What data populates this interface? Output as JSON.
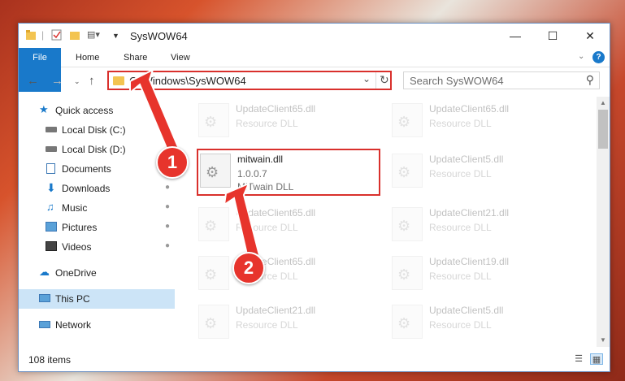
{
  "window": {
    "title": "SysWOW64"
  },
  "ribbon": {
    "tabs": [
      "File",
      "Home",
      "Share",
      "View"
    ]
  },
  "address": {
    "path": "C:\\Windows\\SysWOW64"
  },
  "search": {
    "placeholder": "Search SysWOW64"
  },
  "sidebar": {
    "items": [
      {
        "label": "Quick access",
        "icon": "star-icon"
      },
      {
        "label": "Local Disk (C:)",
        "icon": "drive-icon",
        "pinned": true
      },
      {
        "label": "Local Disk (D:)",
        "icon": "drive-icon"
      },
      {
        "label": "Documents",
        "icon": "documents-icon"
      },
      {
        "label": "Downloads",
        "icon": "download-icon",
        "pinned": true
      },
      {
        "label": "Music",
        "icon": "music-icon",
        "pinned": true
      },
      {
        "label": "Pictures",
        "icon": "pictures-icon",
        "pinned": true
      },
      {
        "label": "Videos",
        "icon": "videos-icon",
        "pinned": true
      },
      {
        "label": "OneDrive",
        "icon": "cloud-icon"
      },
      {
        "label": "This PC",
        "icon": "computer-icon",
        "selected": true
      },
      {
        "label": "Network",
        "icon": "network-icon"
      }
    ]
  },
  "files": [
    {
      "name": "UpdateClient65.dll",
      "type": "Resource DLL"
    },
    {
      "name": "UpdateClient65.dll",
      "type": "Resource DLL"
    },
    {
      "name": "mitwain.dll",
      "version": "1.0.0.7",
      "type": "MiTwain DLL"
    },
    {
      "name": "UpdateClient5.dll",
      "type": "Resource DLL"
    },
    {
      "name": "UpdateClient65.dll",
      "type": "Resource DLL"
    },
    {
      "name": "UpdateClient21.dll",
      "type": "Resource DLL"
    },
    {
      "name": "UpdateClient65.dll",
      "type": "Resource DLL"
    },
    {
      "name": "UpdateClient19.dll",
      "type": "Resource DLL"
    },
    {
      "name": "UpdateClient21.dll",
      "type": "Resource DLL"
    },
    {
      "name": "UpdateClient5.dll",
      "type": "Resource DLL"
    }
  ],
  "status": {
    "count": "108 items"
  },
  "annotations": {
    "badge1": "1",
    "badge2": "2"
  },
  "colors": {
    "accent": "#1979ca",
    "highlight": "#d9302c",
    "badge": "#e7342c"
  }
}
